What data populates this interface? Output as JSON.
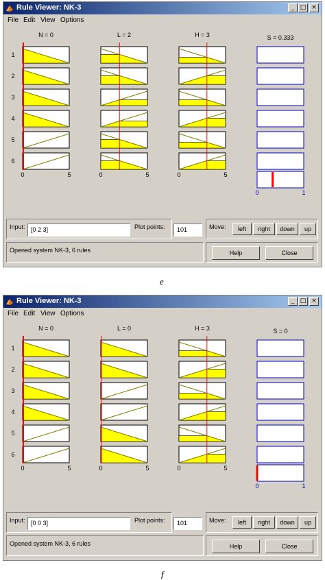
{
  "windows": [
    {
      "title": "Rule Viewer: NK-3",
      "menu": [
        "File",
        "Edit",
        "View",
        "Options"
      ],
      "columns": [
        "N = 0",
        "L = 2",
        "H = 3"
      ],
      "output_title": "S = 0.333",
      "rule_numbers": [
        "1",
        "2",
        "3",
        "4",
        "5",
        "6"
      ],
      "axis_min": "0",
      "axis_max": "5",
      "out_axis_min": "0",
      "out_axis_max": "1",
      "input_label": "Input:",
      "input_value": "[0 2 3]",
      "plot_points_label": "Plot points:",
      "plot_points_value": "101",
      "move_label": "Move:",
      "buttons": [
        "left",
        "right",
        "down",
        "up"
      ],
      "status": "Opened system NK-3, 6 rules",
      "help_label": "Help",
      "close_label": "Close",
      "input_values": [
        0,
        2,
        3
      ],
      "output_value": 0.333,
      "rules": [
        [
          {
            "mf": "dec",
            "active": true
          },
          {
            "mf": "dec",
            "active": true
          },
          {
            "mf": "dec",
            "active": true
          }
        ],
        [
          {
            "mf": "dec",
            "active": true
          },
          {
            "mf": "dec",
            "active": true
          },
          {
            "mf": "inc",
            "active": true
          }
        ],
        [
          {
            "mf": "dec",
            "active": true
          },
          {
            "mf": "inc",
            "active": true
          },
          {
            "mf": "dec",
            "active": true
          }
        ],
        [
          {
            "mf": "dec",
            "active": true
          },
          {
            "mf": "inc",
            "active": true
          },
          {
            "mf": "inc",
            "active": true
          }
        ],
        [
          {
            "mf": "inc",
            "active": false
          },
          {
            "mf": "dec",
            "active": true
          },
          {
            "mf": "dec",
            "active": true
          }
        ],
        [
          {
            "mf": "inc",
            "active": false
          },
          {
            "mf": "dec",
            "active": true
          },
          {
            "mf": "inc",
            "active": true
          }
        ]
      ],
      "caption": "e"
    },
    {
      "title": "Rule Viewer: NK-3",
      "menu": [
        "File",
        "Edit",
        "View",
        "Options"
      ],
      "columns": [
        "N = 0",
        "L = 0",
        "H = 3"
      ],
      "output_title": "S = 0",
      "rule_numbers": [
        "1",
        "2",
        "3",
        "4",
        "5",
        "6"
      ],
      "axis_min": "0",
      "axis_max": "5",
      "out_axis_min": "0",
      "out_axis_max": "1",
      "input_label": "Input:",
      "input_value": "[0 0 3]",
      "plot_points_label": "Plot points:",
      "plot_points_value": "101",
      "move_label": "Move:",
      "buttons": [
        "left",
        "right",
        "down",
        "up"
      ],
      "status": "Opened system NK-3, 6 rules",
      "help_label": "Help",
      "close_label": "Close",
      "input_values": [
        0,
        0,
        3
      ],
      "output_value": 0,
      "rules": [
        [
          {
            "mf": "dec",
            "active": true
          },
          {
            "mf": "dec",
            "active": true
          },
          {
            "mf": "dec",
            "active": true
          }
        ],
        [
          {
            "mf": "dec",
            "active": true
          },
          {
            "mf": "dec",
            "active": true
          },
          {
            "mf": "inc",
            "active": true
          }
        ],
        [
          {
            "mf": "dec",
            "active": true
          },
          {
            "mf": "inc",
            "active": false
          },
          {
            "mf": "dec",
            "active": true
          }
        ],
        [
          {
            "mf": "dec",
            "active": true
          },
          {
            "mf": "inc",
            "active": false
          },
          {
            "mf": "inc",
            "active": true
          }
        ],
        [
          {
            "mf": "inc",
            "active": false
          },
          {
            "mf": "dec",
            "active": true
          },
          {
            "mf": "dec",
            "active": true
          }
        ],
        [
          {
            "mf": "inc",
            "active": false
          },
          {
            "mf": "dec",
            "active": true
          },
          {
            "mf": "inc",
            "active": true
          }
        ]
      ],
      "caption": "f"
    }
  ],
  "colors": {
    "title_bar": "#0a246a",
    "window_bg": "#d4d0c8",
    "mf_fill": "#ffff00",
    "mf_line": "#808000",
    "input_line": "#ff0000",
    "output_frame": "#0000c0",
    "output_marker": "#ff0000"
  }
}
